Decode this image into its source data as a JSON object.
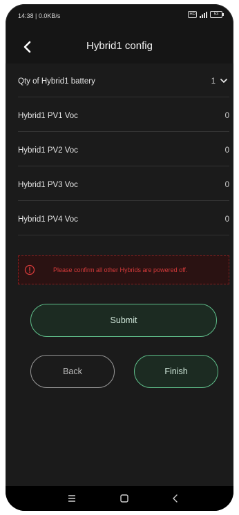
{
  "status": {
    "time_speed": "14:38 | 0.0KB/s",
    "hd_label": "HD",
    "battery_level": "53"
  },
  "header": {
    "title": "Hybrid1 config"
  },
  "rows": [
    {
      "label": "Qty of Hybrid1 battery",
      "value": "1"
    },
    {
      "label": "Hybrid1 PV1 Voc",
      "value": "0"
    },
    {
      "label": "Hybrid1 PV2 Voc",
      "value": "0"
    },
    {
      "label": "Hybrid1 PV3 Voc",
      "value": "0"
    },
    {
      "label": "Hybrid1 PV4 Voc",
      "value": "0"
    }
  ],
  "warning": {
    "text": "Please confirm all other Hybrids are powered off."
  },
  "buttons": {
    "submit": "Submit",
    "back": "Back",
    "finish": "Finish"
  },
  "colors": {
    "accent": "#5fbe8a",
    "warning": "#d43a3a",
    "background": "#151515"
  },
  "icons": [
    "back-arrow-icon",
    "chevron-down-icon",
    "warning-circle-icon",
    "menu-icon",
    "home-square-icon",
    "back-nav-icon"
  ]
}
